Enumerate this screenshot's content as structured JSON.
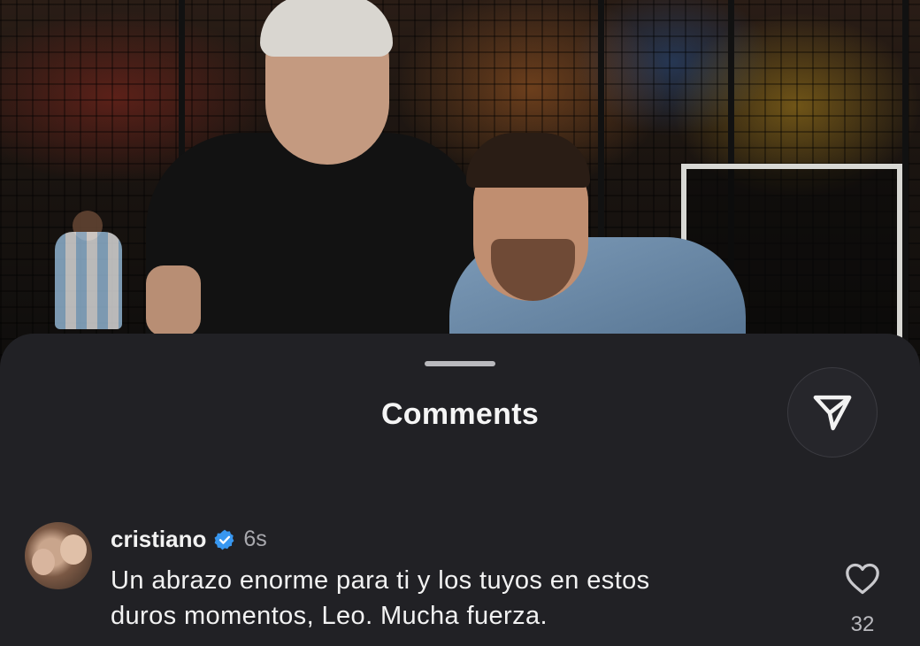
{
  "photo": {
    "description_icon": "photo-background"
  },
  "sheet": {
    "title": "Comments",
    "share_icon": "send-icon"
  },
  "comment": {
    "username": "cristiano",
    "verified": true,
    "time": "6s",
    "text_line1": "Un abrazo enorme para ti y los tuyos en estos",
    "text_line2": "duros momentos, Leo. Mucha fuerza.",
    "likes": "32",
    "like_icon": "heart-icon"
  },
  "colors": {
    "sheet_bg": "#212125",
    "verified_blue": "#3897f0",
    "text_primary": "#f2f2f2",
    "text_secondary": "#a9a9ae"
  }
}
